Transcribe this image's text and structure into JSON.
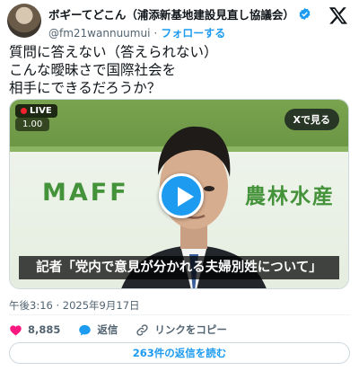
{
  "author": {
    "display_name": "ボギーてどこん（浦添新基地建設見直し協議会）",
    "handle": "@fm21wannuumui",
    "separator": "·",
    "follow_label": "フォローする"
  },
  "tweet": {
    "lines": [
      "質問に答えない（答えられない）",
      "こんな曖昧さで国際社会を",
      "相手にできるだろうか？"
    ]
  },
  "media": {
    "live_label": "LIVE",
    "speed_label": "1.00",
    "view_on_x_label": "Xで見る",
    "sign_text": "MAFF",
    "sign_kanji": "農林水産",
    "caption": "記者「党内で意見が分かれる夫婦別姓について」"
  },
  "timestamp": "午後3:16 · 2025年9月17日",
  "actions": {
    "like_count": "8,885",
    "reply_label": "返信",
    "copy_link_label": "リンクをコピー"
  },
  "replies_button_label": "263件の返信を読む",
  "colors": {
    "accent": "#1d9bf0",
    "like": "#f91880",
    "text": "#0f1419",
    "secondary": "#536471"
  }
}
